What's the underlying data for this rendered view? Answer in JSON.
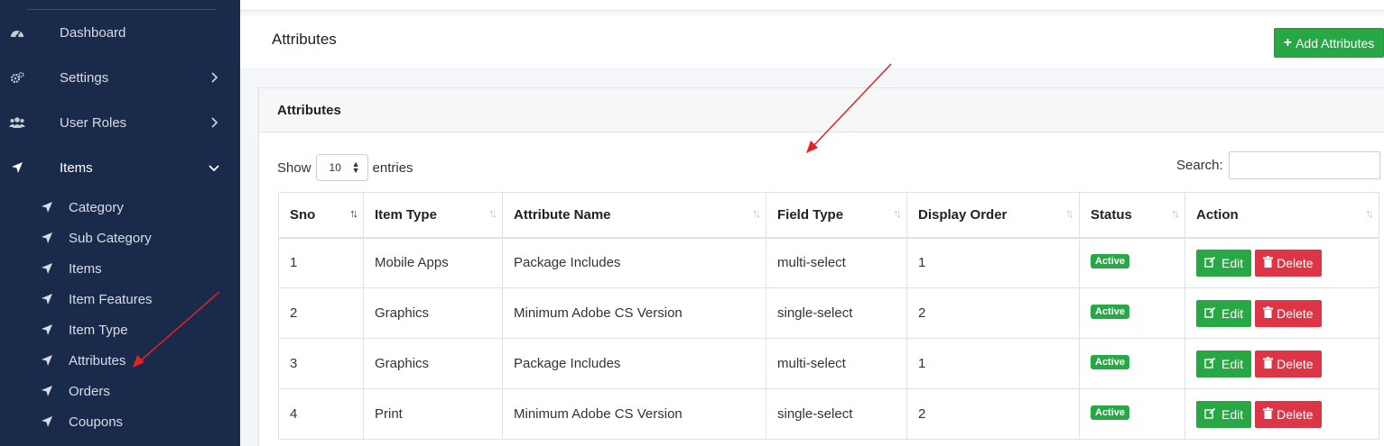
{
  "sidebar": {
    "items": [
      {
        "label": "Dashboard",
        "icon": "dashboard-icon"
      },
      {
        "label": "Settings",
        "icon": "cogs-icon"
      },
      {
        "label": "User Roles",
        "icon": "users-icon"
      },
      {
        "label": "Items",
        "icon": "location-arrow-icon"
      }
    ],
    "subitems": [
      {
        "label": "Category"
      },
      {
        "label": "Sub Category"
      },
      {
        "label": "Items"
      },
      {
        "label": "Item Features"
      },
      {
        "label": "Item Type"
      },
      {
        "label": "Attributes"
      },
      {
        "label": "Orders"
      },
      {
        "label": "Coupons"
      }
    ]
  },
  "header": {
    "title": "Attributes",
    "add_button": "Add Attributes"
  },
  "card": {
    "title": "Attributes",
    "show_label": "Show",
    "entries_value": "10",
    "entries_label": "entries",
    "search_label": "Search:"
  },
  "table": {
    "columns": [
      "Sno",
      "Item Type",
      "Attribute Name",
      "Field Type",
      "Display Order",
      "Status",
      "Action"
    ],
    "rows": [
      {
        "sno": "1",
        "item_type": "Mobile Apps",
        "attribute_name": "Package Includes",
        "field_type": "multi-select",
        "display_order": "1",
        "status": "Active"
      },
      {
        "sno": "2",
        "item_type": "Graphics",
        "attribute_name": "Minimum Adobe CS Version",
        "field_type": "single-select",
        "display_order": "2",
        "status": "Active"
      },
      {
        "sno": "3",
        "item_type": "Graphics",
        "attribute_name": "Package Includes",
        "field_type": "multi-select",
        "display_order": "1",
        "status": "Active"
      },
      {
        "sno": "4",
        "item_type": "Print",
        "attribute_name": "Minimum Adobe CS Version",
        "field_type": "single-select",
        "display_order": "2",
        "status": "Active"
      }
    ],
    "edit_label": "Edit",
    "delete_label": "Delete"
  },
  "colors": {
    "sidebar_bg": "#1a2a4a",
    "success": "#28a745",
    "danger": "#dc3545",
    "annotation_arrow": "#e02424"
  }
}
